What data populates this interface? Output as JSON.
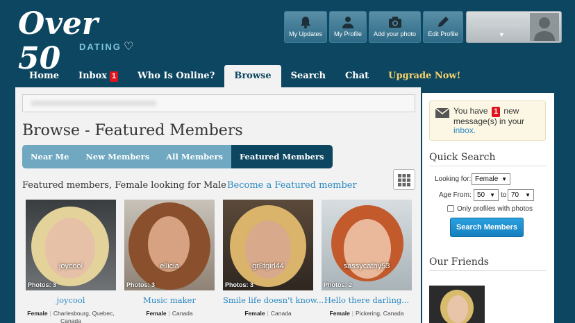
{
  "logo": {
    "main": "Over 50",
    "sub": "DATING"
  },
  "top_buttons": [
    {
      "label": "My Updates",
      "icon": "bell-icon"
    },
    {
      "label": "My Profile",
      "icon": "user-icon"
    },
    {
      "label": "Add your photo",
      "icon": "camera-icon"
    },
    {
      "label": "Edit Profile",
      "icon": "pencil-icon"
    }
  ],
  "nav": {
    "home": "Home",
    "inbox": "Inbox",
    "inbox_count": "1",
    "who_online": "Who Is Online?",
    "browse": "Browse",
    "search": "Search",
    "chat": "Chat",
    "upgrade": "Upgrade Now!"
  },
  "page": {
    "title": "Browse - Featured Members",
    "tabs": [
      "Near Me",
      "New Members",
      "All Members",
      "Featured Members"
    ],
    "subheading": "Featured members, Female looking for Male",
    "become_featured": "Become a Featured member"
  },
  "members": [
    {
      "username": "joycool",
      "photos": "Photos: 3",
      "headline": "joycool",
      "gender": "Female",
      "location": "Charlesbourg, Quebec, Canada"
    },
    {
      "username": "ellicia",
      "photos": "Photos: 3",
      "headline": "Music maker",
      "gender": "Female",
      "location": "Canada"
    },
    {
      "username": "gr8tgirl44",
      "photos": "Photos: 3",
      "headline": "Smile life doesn't know...",
      "gender": "Female",
      "location": "Canada"
    },
    {
      "username": "sassycathy53",
      "photos": "Photos: 2",
      "headline": "Hello there darling...",
      "gender": "Female",
      "location": "Pickering, Canada"
    }
  ],
  "messages": {
    "prefix": "You have",
    "count": "1",
    "suffix": "new message(s) in your",
    "link": "inbox."
  },
  "quick_search": {
    "title": "Quick Search",
    "looking_for_label": "Looking for:",
    "looking_for_value": "Female",
    "age_from_label": "Age From:",
    "age_from_value": "50",
    "age_to_label": "to",
    "age_to_value": "70",
    "photos_only_label": "Only profiles with photos",
    "submit_label": "Search Members"
  },
  "friends": {
    "title": "Our Friends"
  },
  "colors": {
    "header_bg": "#0d4660",
    "accent": "#2a89c2",
    "upgrade": "#f6d36b",
    "badge": "#e0141e"
  }
}
